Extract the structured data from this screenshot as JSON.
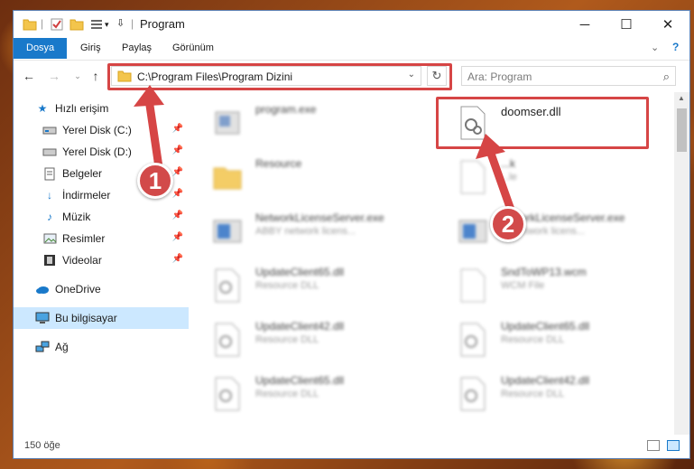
{
  "window": {
    "title": "Program",
    "controls": {
      "minimize": "─",
      "maximize": "☐",
      "close": "✕"
    }
  },
  "ribbon": {
    "tabs": [
      "Dosya",
      "Giriş",
      "Paylaş",
      "Görünüm"
    ]
  },
  "nav": {
    "address": "C:\\Program Files\\Program Dizini",
    "search_placeholder": "Ara: Program"
  },
  "sidebar": {
    "items": [
      {
        "label": "Hızlı erişim",
        "icon": "star-icon"
      },
      {
        "label": "Yerel Disk (C:)",
        "icon": "drive-icon",
        "pinned": true
      },
      {
        "label": "Yerel Disk (D:)",
        "icon": "drive-icon",
        "pinned": true
      },
      {
        "label": "Belgeler",
        "icon": "document-icon",
        "pinned": true
      },
      {
        "label": "İndirmeler",
        "icon": "download-icon",
        "pinned": true
      },
      {
        "label": "Müzik",
        "icon": "music-icon",
        "pinned": true
      },
      {
        "label": "Resimler",
        "icon": "pictures-icon",
        "pinned": true
      },
      {
        "label": "Videolar",
        "icon": "video-icon",
        "pinned": true
      },
      {
        "label": "OneDrive",
        "icon": "cloud-icon"
      },
      {
        "label": "Bu bilgisayar",
        "icon": "computer-icon",
        "selected": true
      },
      {
        "label": "Ağ",
        "icon": "network-icon"
      }
    ]
  },
  "files": [
    {
      "name": "program.exe",
      "sub": "",
      "type": "exe",
      "blurred": true
    },
    {
      "name": "doomser.dll",
      "sub": "",
      "type": "dll",
      "blurred": false,
      "highlighted": true
    },
    {
      "name": "Resource",
      "sub": "",
      "type": "folder",
      "blurred": true
    },
    {
      "name": "...k",
      "sub": "...le",
      "type": "file",
      "blurred": true
    },
    {
      "name": "NetworkLicenseServer.exe",
      "sub": "ABBY network licens...",
      "type": "exe",
      "blurred": true
    },
    {
      "name": "...tworkLicenseServer.exe",
      "sub": "... Network licens...",
      "type": "exe",
      "blurred": true
    },
    {
      "name": "UpdateClient65.dll",
      "sub": "Resource DLL",
      "type": "dll",
      "blurred": true
    },
    {
      "name": "SndToWP13.wcm",
      "sub": "WCM File",
      "type": "file",
      "blurred": true
    },
    {
      "name": "UpdateClient42.dll",
      "sub": "Resource DLL",
      "type": "dll",
      "blurred": true
    },
    {
      "name": "UpdateClient65.dll",
      "sub": "Resource DLL",
      "type": "dll",
      "blurred": true
    },
    {
      "name": "UpdateClient65.dll",
      "sub": "Resource DLL",
      "type": "dll",
      "blurred": true
    },
    {
      "name": "UpdateClient42.dll",
      "sub": "Resource DLL",
      "type": "dll",
      "blurred": true
    }
  ],
  "status": {
    "count": "150 öğe"
  },
  "callouts": [
    "1",
    "2"
  ],
  "colors": {
    "accent": "#1979ca",
    "highlight_box": "#d64545",
    "selection": "#cce8ff"
  }
}
